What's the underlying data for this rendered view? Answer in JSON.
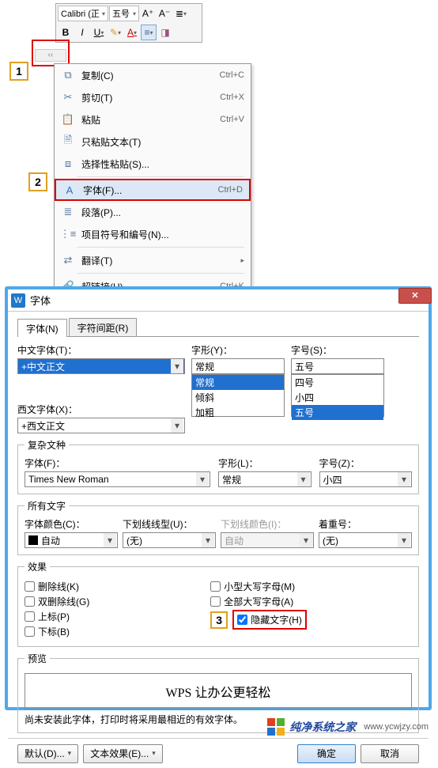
{
  "toolbar": {
    "font_name": "Calibri (正",
    "font_size": "五号",
    "btn_inc": "A⁺",
    "btn_dec": "A⁻",
    "btn_linespace": "≣",
    "btn_bold": "B",
    "btn_italic": "I",
    "btn_underline": "U",
    "btn_highlight": "✎",
    "btn_fontcolor": "A",
    "btn_align": "≡",
    "btn_eraser": "◨"
  },
  "callouts": {
    "c1": "1",
    "c2": "2",
    "c3": "3"
  },
  "ctx": {
    "copy": {
      "label": "复制(C)",
      "short": "Ctrl+C"
    },
    "cut": {
      "label": "剪切(T)",
      "short": "Ctrl+X"
    },
    "paste": {
      "label": "粘贴",
      "short": "Ctrl+V"
    },
    "ptext": {
      "label": "只粘贴文本(T)",
      "short": ""
    },
    "pspec": {
      "label": "选择性粘贴(S)...",
      "short": ""
    },
    "font": {
      "label": "字体(F)...",
      "short": "Ctrl+D"
    },
    "para": {
      "label": "段落(P)...",
      "short": ""
    },
    "bullet": {
      "label": "项目符号和编号(N)...",
      "short": ""
    },
    "trans": {
      "label": "翻译(T)",
      "short": ""
    },
    "link": {
      "label": "超链接(H)...",
      "short": "Ctrl+K"
    }
  },
  "dlg": {
    "title": "字体",
    "tab_font": "字体(N)",
    "tab_spacing": "字符间距(R)",
    "cfont_lbl": "中文字体(T)：",
    "cfont_val": "+中文正文",
    "wfont_lbl": "西文字体(X)：",
    "wfont_val": "+西文正文",
    "style_lbl": "字形(Y)：",
    "style_val": "常规",
    "style_opts": [
      "常规",
      "倾斜",
      "加粗"
    ],
    "size_lbl": "字号(S)：",
    "size_val": "五号",
    "size_opts": [
      "四号",
      "小四",
      "五号"
    ],
    "complex_legend": "复杂文种",
    "cx_font_lbl": "字体(F)：",
    "cx_font_val": "Times New Roman",
    "cx_style_lbl": "字形(L)：",
    "cx_style_val": "常规",
    "cx_size_lbl": "字号(Z)：",
    "cx_size_val": "小四",
    "all_legend": "所有文字",
    "color_lbl": "字体颜色(C)：",
    "color_val": "自动",
    "ustyle_lbl": "下划线线型(U)：",
    "ustyle_val": "(无)",
    "ucolor_lbl": "下划线颜色(I)：",
    "ucolor_val": "自动",
    "emph_lbl": "着重号：",
    "emph_val": "(无)",
    "fx_legend": "效果",
    "fx": {
      "strike": "删除线(K)",
      "dstrike": "双删除线(G)",
      "super": "上标(P)",
      "sub": "下标(B)",
      "smallcaps": "小型大写字母(M)",
      "allcaps": "全部大写字母(A)",
      "hidden": "隐藏文字(H)"
    },
    "preview_legend": "预览",
    "preview_text": "WPS 让办公更轻松",
    "preview_note": "尚未安装此字体，打印时将采用最相近的有效字体。",
    "btn_default": "默认(D)...",
    "btn_texteffect": "文本效果(E)...",
    "btn_ok": "确定",
    "btn_cancel": "取消"
  },
  "wm": {
    "brand": "纯净系统之家",
    "url": "www.ycwjzy.com"
  }
}
